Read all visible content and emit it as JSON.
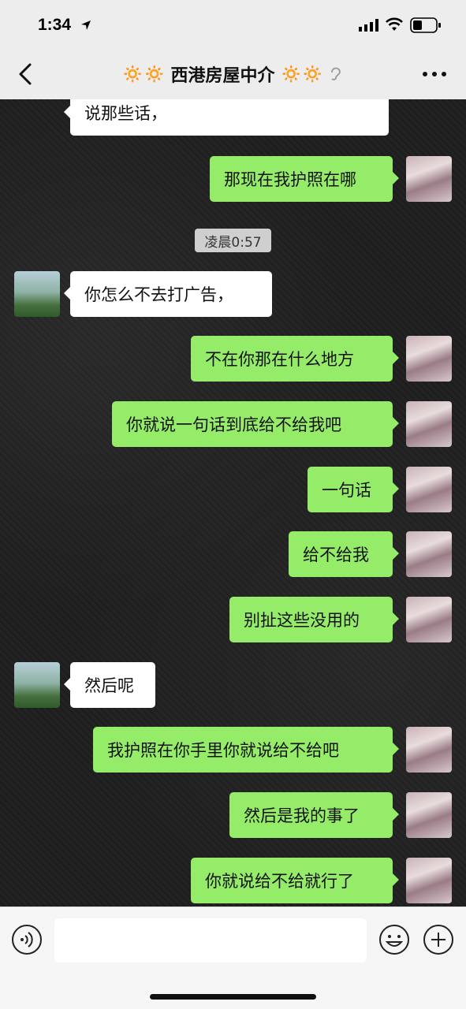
{
  "status_bar": {
    "time": "1:34"
  },
  "header": {
    "title": "西港房屋中介",
    "title_prefix": "🔅🔅",
    "title_suffix": "🔅🔅"
  },
  "timestamp": "凌晨0:57",
  "messages": [
    {
      "side": "left",
      "text": "说那些话，"
    },
    {
      "side": "right",
      "text": "那现在我护照在哪"
    },
    {
      "side": "left",
      "text": "你怎么不去打广告，"
    },
    {
      "side": "right",
      "text": "不在你那在什么地方"
    },
    {
      "side": "right",
      "text": "你就说一句话到底给不给我吧"
    },
    {
      "side": "right",
      "text": "一句话"
    },
    {
      "side": "right",
      "text": "给不给我"
    },
    {
      "side": "right",
      "text": "别扯这些没用的"
    },
    {
      "side": "left",
      "text": "然后呢"
    },
    {
      "side": "right",
      "text": "我护照在你手里你就说给不给吧"
    },
    {
      "side": "right",
      "text": "然后是我的事了"
    },
    {
      "side": "right",
      "text": "你就说给不给就行了"
    }
  ],
  "input": {
    "value": "",
    "placeholder": ""
  },
  "colors": {
    "sent_bubble": "#95ec69",
    "received_bubble": "#ffffff",
    "header_bg": "#ededed"
  },
  "icons": [
    "location-arrow-icon",
    "signal-icon",
    "wifi-icon",
    "battery-icon",
    "back-arrow-icon",
    "sun-icon",
    "ear-icon",
    "more-icon",
    "voice-icon",
    "emoji-icon",
    "plus-icon"
  ]
}
